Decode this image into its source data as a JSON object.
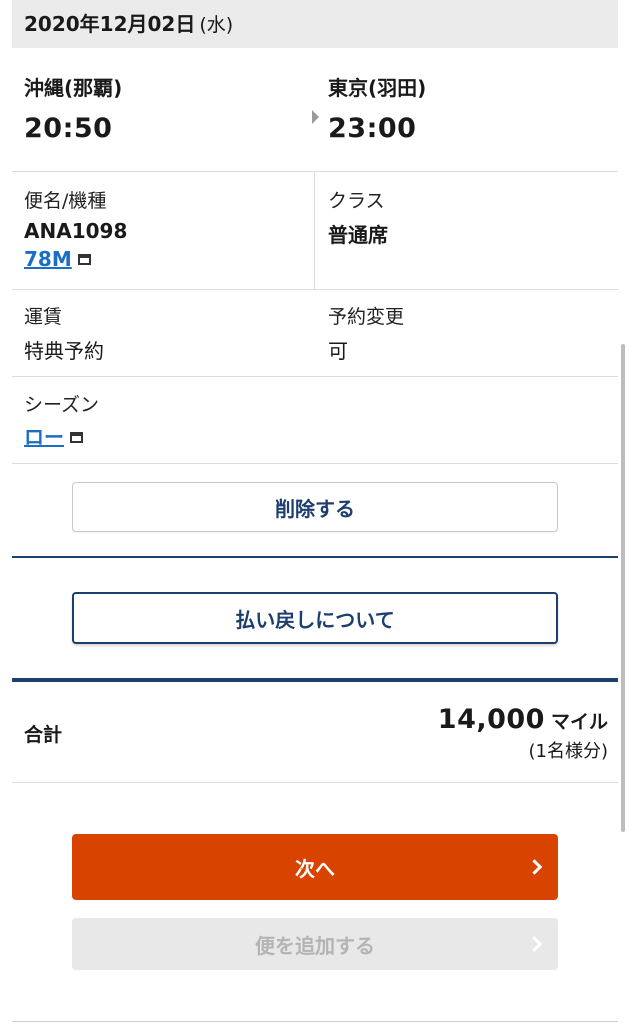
{
  "date": {
    "text": "2020年12月02日",
    "dow": "(水)"
  },
  "route": {
    "from_city": "沖縄(那覇)",
    "from_time": "20:50",
    "to_city": "東京(羽田)",
    "to_time": "23:00"
  },
  "details": {
    "flight_label": "便名/機種",
    "flight_number": "ANA1098",
    "aircraft": "78M",
    "class_label": "クラス",
    "class_value": "普通席",
    "fare_label": "運賃",
    "fare_value": "特典予約",
    "change_label": "予約変更",
    "change_value": "可",
    "season_label": "シーズン",
    "season_value": "ロー"
  },
  "buttons": {
    "delete": "削除する",
    "refund": "払い戻しについて",
    "next": "次へ",
    "add_flight": "便を追加する"
  },
  "total": {
    "label": "合計",
    "amount": "14,000",
    "unit": "マイル",
    "per": "(1名様分)"
  },
  "colors": {
    "navy": "#1c3f6e",
    "accent": "#d84400",
    "link": "#1a6fc4"
  }
}
